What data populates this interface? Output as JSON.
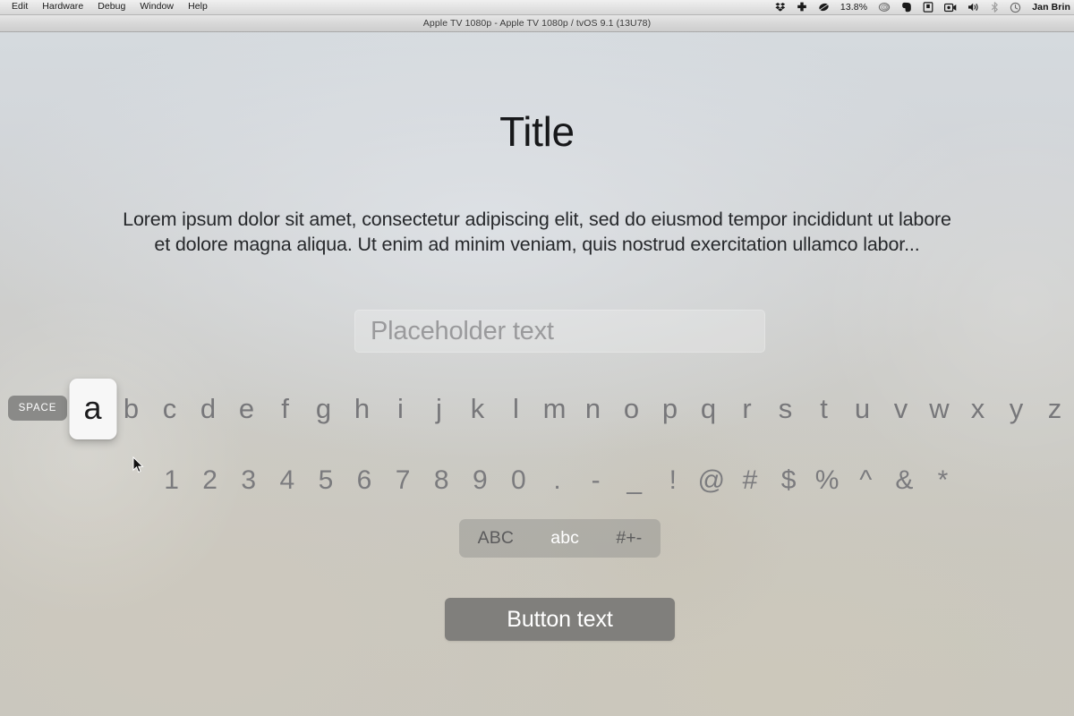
{
  "menubar": {
    "items": [
      {
        "label": "Edit"
      },
      {
        "label": "Hardware"
      },
      {
        "label": "Debug"
      },
      {
        "label": "Window"
      },
      {
        "label": "Help"
      }
    ],
    "status": {
      "dropbox_icon": "dropbox-icon",
      "health_icon": "medical-cross-icon",
      "leaf_icon": "leaf-icon",
      "battery_percent": "13.8%",
      "spiral_icon": "spiral-icon",
      "evernote_icon": "evernote-elephant-icon",
      "notebook_icon": "notebook-icon",
      "screen_record_icon": "screen-record-icon",
      "volume_icon": "volume-icon",
      "bluetooth_icon": "bluetooth-icon",
      "clock_icon": "clock-icon",
      "user_name": "Jan Brin"
    }
  },
  "window": {
    "title": "Apple TV 1080p - Apple TV 1080p / tvOS 9.1 (13U78)"
  },
  "content": {
    "title": "Title",
    "body": "Lorem ipsum dolor sit amet, consectetur adipiscing elit, sed do eiusmod tempor incididunt ut labore et dolore magna aliqua. Ut enim ad minim veniam, quis nostrud exercitation ullamco labor...",
    "textfield": {
      "value": "",
      "placeholder": "Placeholder text"
    },
    "button": {
      "label": "Button text"
    }
  },
  "keyboard": {
    "space_label": "SPACE",
    "focused_key": "a",
    "alpha_keys": [
      "a",
      "b",
      "c",
      "d",
      "e",
      "f",
      "g",
      "h",
      "i",
      "j",
      "k",
      "l",
      "m",
      "n",
      "o",
      "p",
      "q",
      "r",
      "s",
      "t",
      "u",
      "v",
      "w",
      "x",
      "y",
      "z"
    ],
    "symbol_keys": [
      "1",
      "2",
      "3",
      "4",
      "5",
      "6",
      "7",
      "8",
      "9",
      "0",
      ".",
      "-",
      "_",
      "!",
      "@",
      "#",
      "$",
      "%",
      "^",
      "&",
      "*"
    ],
    "modes": [
      {
        "label": "ABC",
        "selected": false
      },
      {
        "label": "abc",
        "selected": true
      },
      {
        "label": "#+-",
        "selected": false
      }
    ]
  },
  "colors": {
    "focused_key_bg": "#f7f7f7",
    "space_key_bg": "#8a8a88",
    "button_bg": "#807f7c",
    "mode_selector_bg": "#969692",
    "key_text": "#77777a",
    "title_text": "#17181a",
    "placeholder_text": "#9a9a9c"
  }
}
